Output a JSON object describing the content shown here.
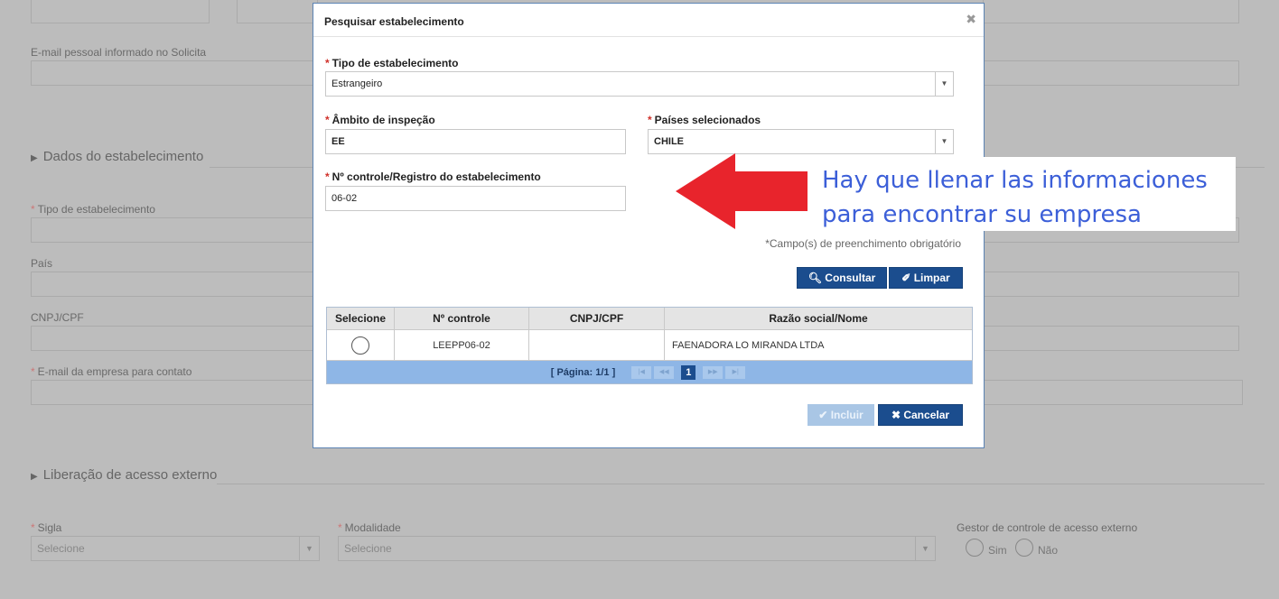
{
  "background": {
    "email_pessoal_label": "E-mail pessoal informado no Solicita",
    "section_dados": "Dados do estabelecimento",
    "tipo_label": "Tipo de estabelecimento",
    "pais_label": "País",
    "cnpj_label": "CNPJ/CPF",
    "email_empresa_label": "E-mail da empresa para contato",
    "section_liberacao": "Liberação de acesso externo",
    "sigla_label": "Sigla",
    "sigla_value": "Selecione",
    "modalidade_label": "Modalidade",
    "modalidade_value": "Selecione",
    "gestor_label": "Gestor de controle de acesso externo",
    "sim_label": "Sim",
    "nao_label": "Não"
  },
  "modal": {
    "title": "Pesquisar estabelecimento",
    "tipo_label": "Tipo de estabelecimento",
    "tipo_value": "Estrangeiro",
    "ambito_label": "Âmbito de inspeção",
    "ambito_value": "EE",
    "paises_label": "Países selecionados",
    "paises_value": "CHILE",
    "controle_label": "Nº controle/Registro do estabelecimento",
    "controle_value": "06-02",
    "required_note": "*Campo(s) de preenchimento obrigatório",
    "consultar_label": "Consultar",
    "limpar_label": "Limpar",
    "incluir_label": "Incluir",
    "cancelar_label": "Cancelar"
  },
  "table": {
    "headers": [
      "Selecione",
      "Nº controle",
      "CNPJ/CPF",
      "Razão social/Nome"
    ],
    "rows": [
      {
        "controle": "LEEPP06-02",
        "cnpj": "",
        "razao": "FAENADORA LO MIRANDA LTDA"
      }
    ],
    "pager_text": "[ Página: 1/1 ]",
    "current_page": "1"
  },
  "annotation": {
    "line1": "Hay que llenar las informaciones",
    "line2": "para encontrar su empresa"
  },
  "colors": {
    "primary_button": "#1b4d8e",
    "required_asterisk": "#d0302a",
    "annotation_arrow": "#e8242c",
    "annotation_text": "#3c5fd8"
  }
}
